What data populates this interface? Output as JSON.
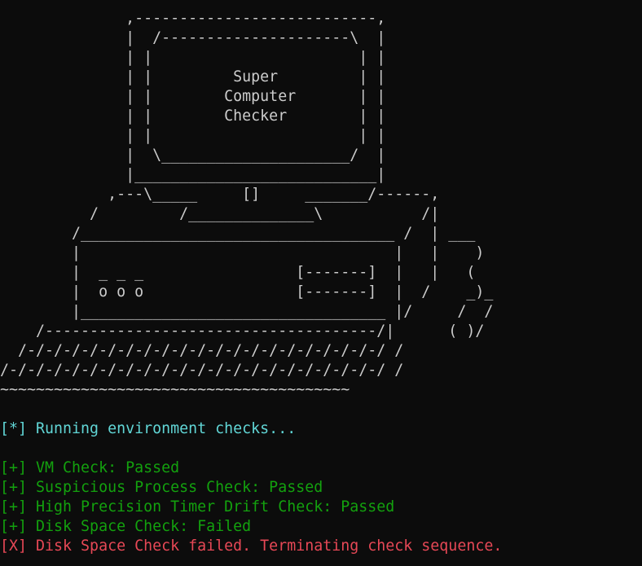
{
  "terminal": {
    "ascii_art": [
      "              ,---------------------------,",
      "              |  /---------------------\\  |",
      "              | |                       | |",
      "              | |         Super         | |",
      "              | |        Computer       | |",
      "              | |        Checker        | |",
      "              | |                       | |",
      "              |  \\_____________________/  |",
      "              |___________________________|",
      "            ,---\\_____     []     _______/------,",
      "          /         /______________\\           /|",
      "        /___________________________________ /  | ___",
      "        |                                   |   |    )",
      "        |  _ _ _                 [-------]  |   |   (",
      "        |  o o o                 [-------]  |  /    _)_",
      "        |__________________________________ |/     /  /",
      "    /-------------------------------------/|      ( )/",
      "  /-/-/-/-/-/-/-/-/-/-/-/-/-/-/-/-/-/-/-/-/ /",
      "/-/-/-/-/-/-/-/-/-/-/-/-/-/-/-/-/-/-/-/-/-/ /",
      "~~~~~~~~~~~~~~~~~~~~~~~~~~~~~~~~~~~~~~~"
    ],
    "running_line": "[*] Running environment checks...",
    "results": [
      {
        "text": "[+] VM Check: Passed",
        "status": "ok"
      },
      {
        "text": "[+] Suspicious Process Check: Passed",
        "status": "ok"
      },
      {
        "text": "[+] High Precision Timer Drift Check: Passed",
        "status": "ok"
      },
      {
        "text": "[+] Disk Space Check: Failed",
        "status": "ok"
      },
      {
        "text": "[X] Disk Space Check failed. Terminating check sequence.",
        "status": "err"
      }
    ]
  },
  "colors": {
    "background": "#0c0c0c",
    "art": "#cccccc",
    "info": "#61d6d6",
    "ok": "#13a10e",
    "err": "#e74856"
  }
}
